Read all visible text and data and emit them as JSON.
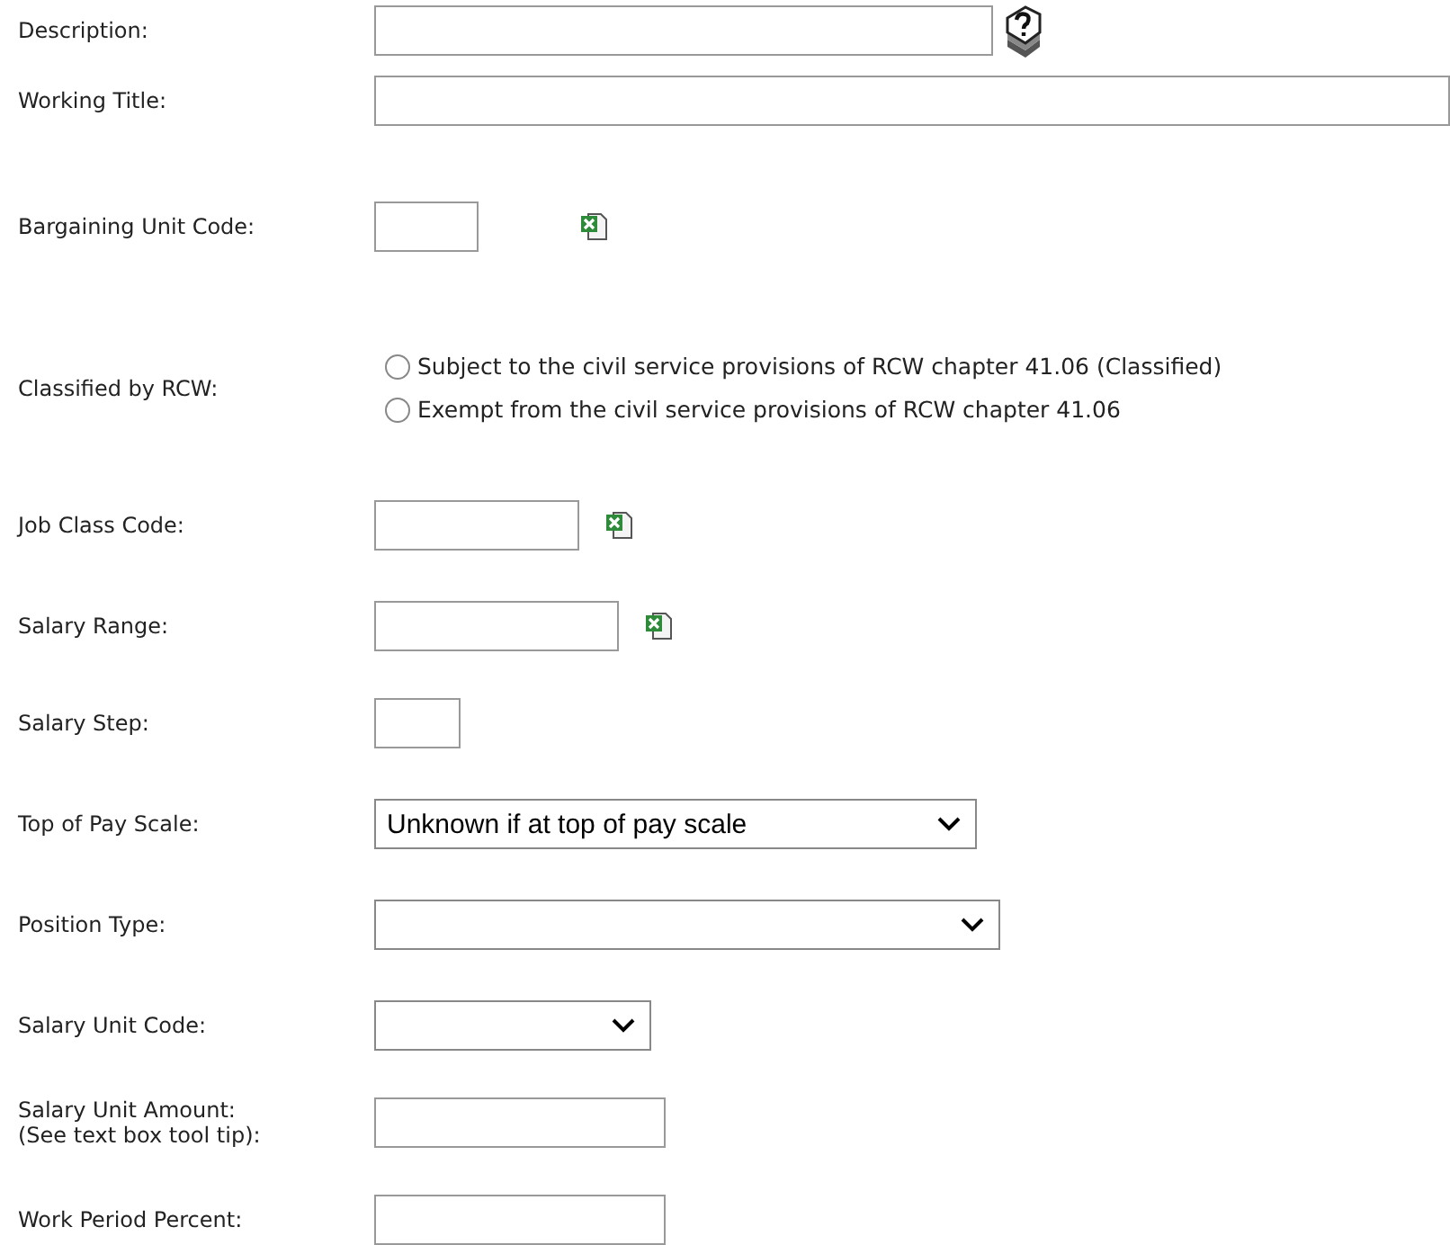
{
  "fields": [
    {
      "kind": "text",
      "label": "Description:"
    },
    {
      "kind": "text",
      "label": "Working Title:"
    },
    {
      "kind": "text",
      "label": "Bargaining Unit Code:"
    },
    {
      "kind": "radio",
      "label": "Classified by RCW:",
      "options": [
        {
          "label": "Subject to the civil service provisions of RCW chapter 41.06 (Classified)",
          "selected": false
        },
        {
          "label": "Exempt from the civil service provisions of RCW chapter 41.06",
          "selected": false
        }
      ]
    },
    {
      "kind": "text",
      "label": "Job Class Code:"
    },
    {
      "kind": "text",
      "label": "Salary Range:"
    },
    {
      "kind": "text",
      "label": "Salary Step:"
    },
    {
      "kind": "select",
      "label": "Top of Pay Scale:",
      "value": "Unknown if at top of pay scale"
    },
    {
      "kind": "select",
      "label": "Position Type:"
    },
    {
      "kind": "select",
      "label": "Salary Unit Code:"
    },
    {
      "kind": "text",
      "label": "Salary Unit Amount:\n(See text box tool tip):"
    },
    {
      "kind": "text",
      "label": "Work Period Percent:"
    }
  ]
}
